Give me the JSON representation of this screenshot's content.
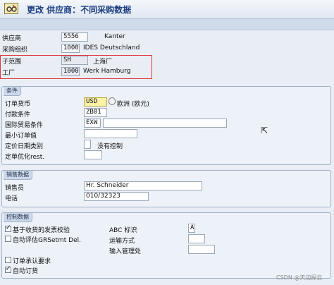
{
  "title": "更改 供应商：不同采购数据",
  "header": {
    "vendor_label": "供应商",
    "vendor_value": "5556",
    "vendor_desc": "Kanter",
    "porg_label": "采购组织",
    "porg_value": "1000",
    "porg_desc": "IDES Deutschland",
    "subrange_label": "子范围",
    "subrange_value": "SH",
    "subrange_desc": "上海厂",
    "plant_label": "工厂",
    "plant_value": "1000",
    "plant_desc": "Werk Hamburg"
  },
  "conditions": {
    "section_title": "条件",
    "currency_label": "订单货币",
    "currency_value": "USD",
    "currency_desc": "欧洲 (欧元)",
    "payterms_label": "付款条件",
    "payterms_value": "ZB01",
    "incoterms_label": "国际贸易条件",
    "incoterms_value": "EXW",
    "minval_label": "最小订单值",
    "pricedate_label": "定价日期类别",
    "pricedate_desc": "没有控制",
    "orderopt_label": "定单优化rest."
  },
  "sales": {
    "section_title": "销售数据",
    "salesperson_label": "销售员",
    "salesperson_value": "Hr. Schneider",
    "phone_label": "电话",
    "phone_value": "010/32323"
  },
  "control": {
    "section_title": "控制数据",
    "gr_inv_label": "基于收货的发票校验",
    "gr_inv_checked": true,
    "auto_eval_label": "自动评估GRSetmt Del.",
    "auto_eval_checked": false,
    "abc_label": "ABC 标识",
    "abc_value": "A",
    "transport_label": "运输方式",
    "entry_office_label": "输入管理处",
    "ack_label": "订单承认要求",
    "ack_checked": false,
    "auto_po_label": "自动订货",
    "auto_po_checked": true
  },
  "watermark": "CSDN @天边探云"
}
